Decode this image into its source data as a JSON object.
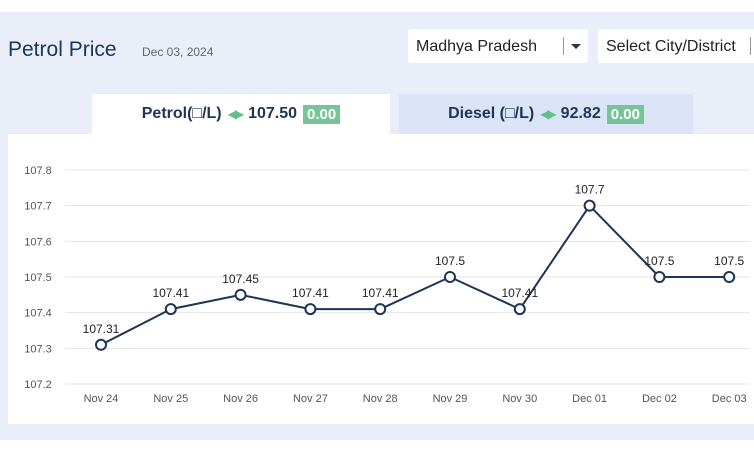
{
  "header": {
    "title": "Petrol Price",
    "date": "Dec 03, 2024",
    "state_select": "Madhya Pradesh",
    "city_select": "Select City/District"
  },
  "tabs": {
    "petrol": {
      "label": "Petrol(□/L)",
      "price": "107.50",
      "change": "0.00"
    },
    "diesel": {
      "label": "Diesel (□/L)",
      "price": "92.82",
      "change": "0.00"
    }
  },
  "colors": {
    "line": "#1d3557",
    "change_badge": "#77c39a",
    "panel_bg": "#e9eef8"
  },
  "chart_data": {
    "type": "line",
    "categories": [
      "Nov 24",
      "Nov 25",
      "Nov 26",
      "Nov 27",
      "Nov 28",
      "Nov 29",
      "Nov 30",
      "Dec 01",
      "Dec 02",
      "Dec 03"
    ],
    "values": [
      107.31,
      107.41,
      107.45,
      107.41,
      107.41,
      107.5,
      107.41,
      107.7,
      107.5,
      107.5
    ],
    "data_labels": [
      "107.31",
      "107.41",
      "107.45",
      "107.41",
      "107.41",
      "107.5",
      "107.41",
      "107.7",
      "107.5",
      "107.5"
    ],
    "y_ticks": [
      "107.2",
      "107.3",
      "107.4",
      "107.5",
      "107.6",
      "107.7",
      "107.8"
    ],
    "ylim": [
      107.2,
      107.8
    ],
    "grid": true,
    "legend": "none"
  }
}
